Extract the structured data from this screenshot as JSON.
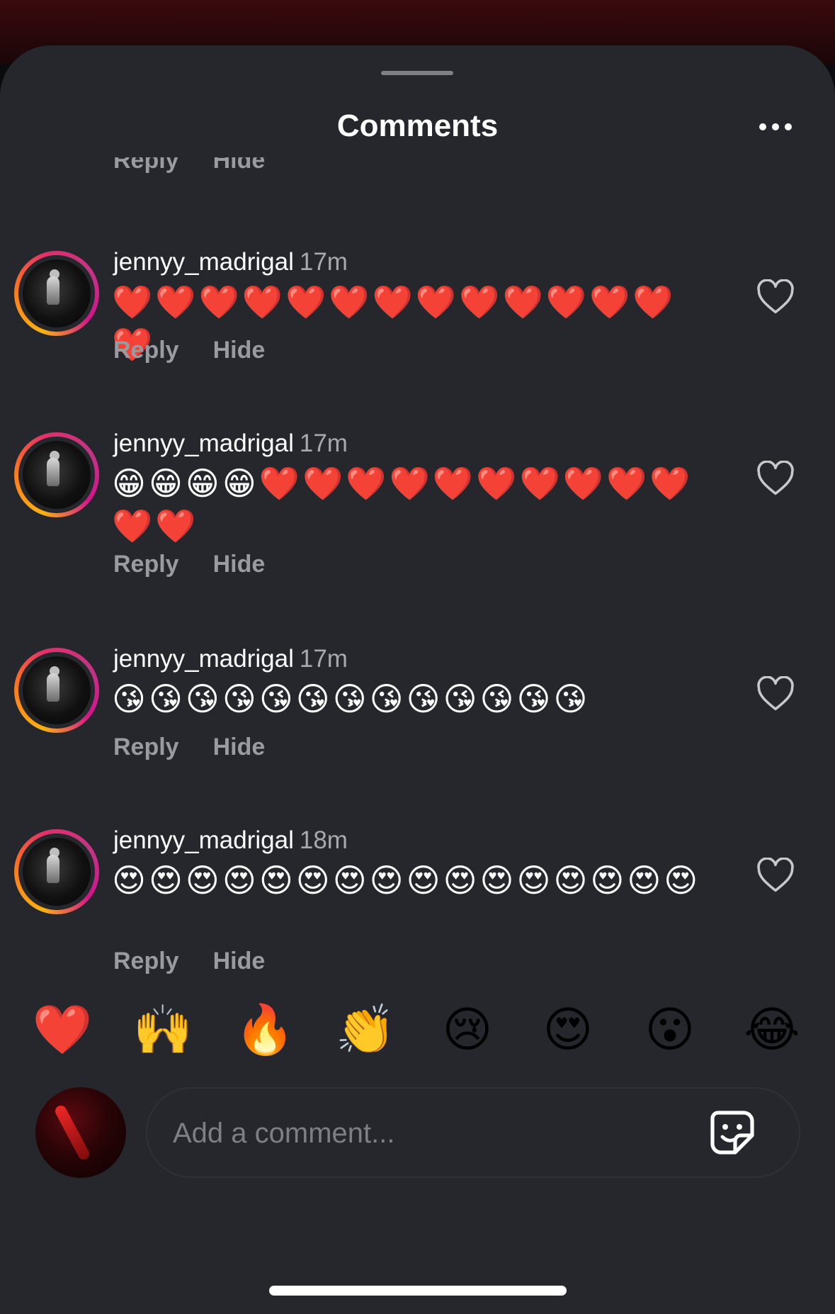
{
  "header": {
    "title": "Comments",
    "more_icon": "more-horizontal-icon"
  },
  "partial_comment": {
    "reply_label": "Reply",
    "hide_label": "Hide"
  },
  "comments": [
    {
      "username": "jennyy_madrigal",
      "time": "17m",
      "text": "❤️❤️❤️❤️❤️❤️❤️❤️❤️❤️❤️❤️❤️❤️",
      "reply_label": "Reply",
      "hide_label": "Hide",
      "like_icon": "heart-outline-icon"
    },
    {
      "username": "jennyy_madrigal",
      "time": "17m",
      "text": "😁😁😁😁❤️❤️❤️❤️❤️❤️❤️❤️❤️❤️❤️❤️",
      "reply_label": "Reply",
      "hide_label": "Hide",
      "like_icon": "heart-outline-icon"
    },
    {
      "username": "jennyy_madrigal",
      "time": "17m",
      "text": "😘😘😘😘😘😘😘😘😘😘😘😘😘",
      "reply_label": "Reply",
      "hide_label": "Hide",
      "like_icon": "heart-outline-icon"
    },
    {
      "username": "jennyy_madrigal",
      "time": "18m",
      "text": "😍😍😍😍😍😍😍😍😍😍😍😍😍😍😍😍",
      "reply_label": "Reply",
      "hide_label": "Hide",
      "like_icon": "heart-outline-icon"
    }
  ],
  "quick_reactions": [
    "❤️",
    "🙌",
    "🔥",
    "👏",
    "😢",
    "😍",
    "😮",
    "😂"
  ],
  "composer": {
    "placeholder": "Add a comment...",
    "sticker_icon": "sticker-icon"
  }
}
